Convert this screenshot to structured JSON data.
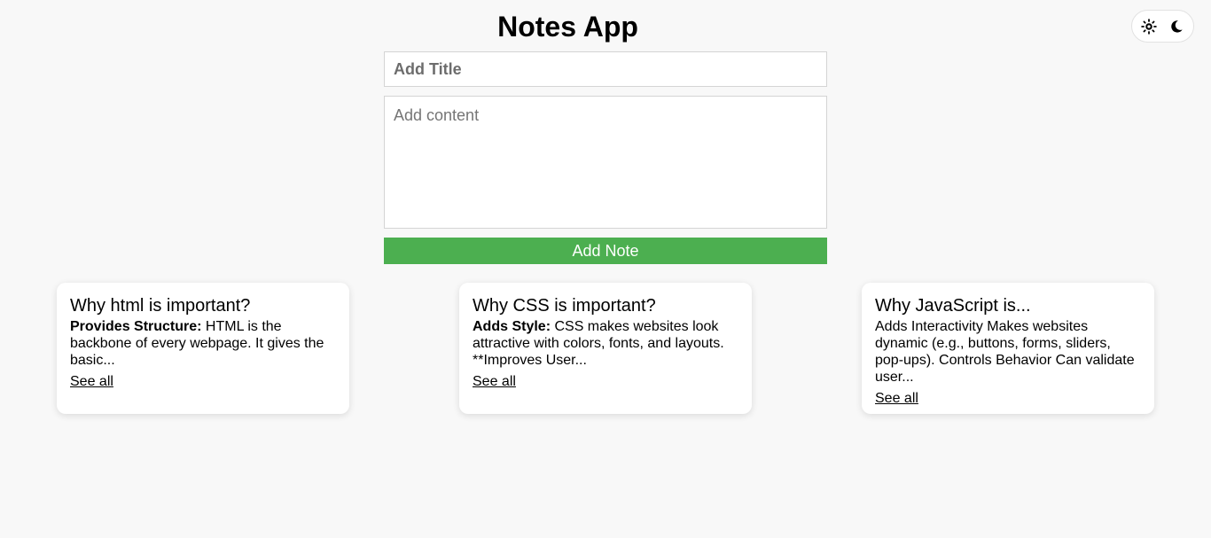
{
  "header": {
    "title": "Notes App"
  },
  "theme_toggle": {
    "light_icon": "sun-icon",
    "dark_icon": "moon-icon"
  },
  "form": {
    "title_placeholder": "Add Title",
    "content_placeholder": "Add content",
    "submit_label": "Add Note",
    "submit_color": "#4caf50"
  },
  "notes": [
    {
      "title": "Why html is important?",
      "lead": "Provides Structure:",
      "body": " HTML is the backbone of every webpage. It gives the basic...",
      "link": "See all"
    },
    {
      "title": "Why CSS is important?",
      "lead": "Adds Style:",
      "body": " CSS makes websites look attractive with colors, fonts, and layouts. **Improves User...",
      "link": "See all"
    },
    {
      "title": "Why JavaScript is...",
      "lead": "",
      "body": "Adds Interactivity Makes websites dynamic (e.g., buttons, forms, sliders, pop-ups). Controls Behavior Can validate user...",
      "link": "See all"
    }
  ]
}
